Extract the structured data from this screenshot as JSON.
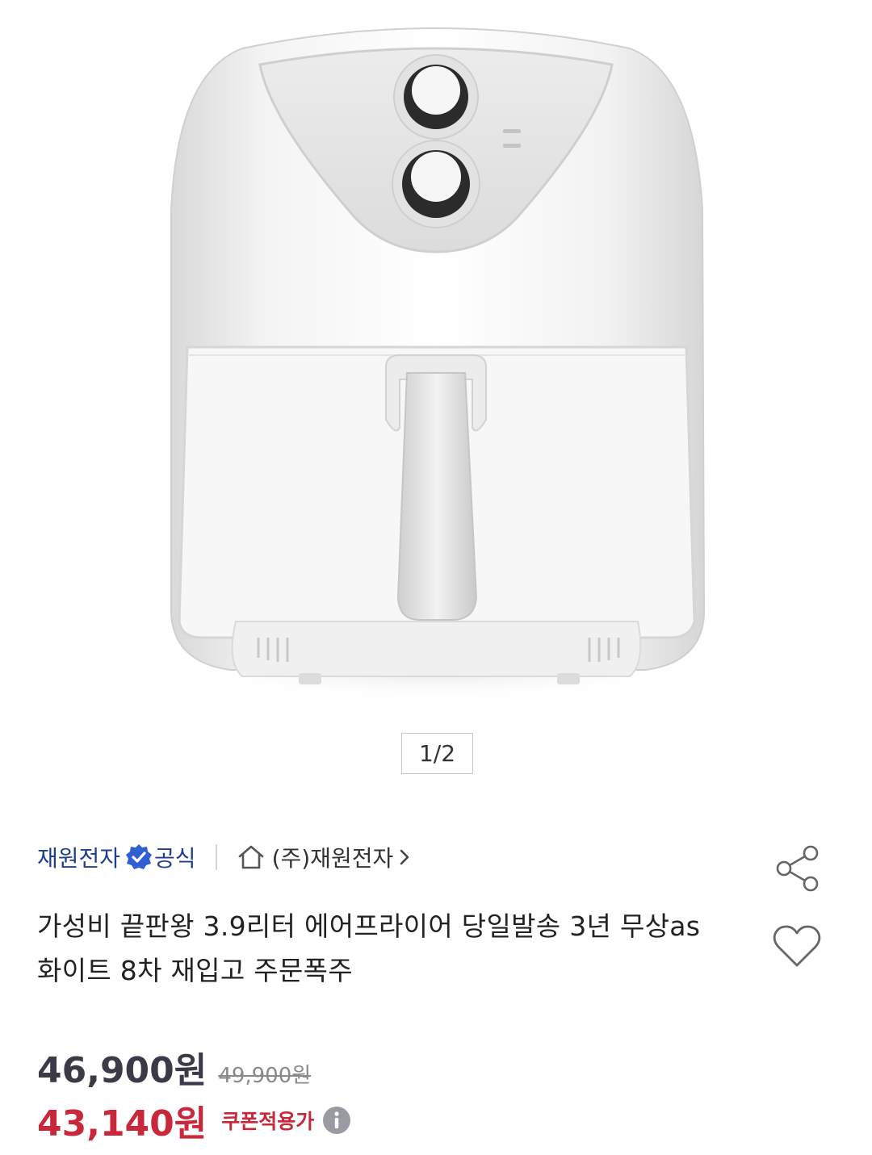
{
  "gallery": {
    "page_indicator": "1/2"
  },
  "seller": {
    "brand": "재원전자",
    "official_label": "공식",
    "store_link": "(주)재원전자"
  },
  "product": {
    "title": "가성비 끝판왕 3.9리터 에어프라이어 당일발송 3년 무상as 화이트 8차 재입고 주문폭주"
  },
  "pricing": {
    "sale_price": "46,900원",
    "original_price": "49,900원",
    "coupon_price": "43,140원",
    "coupon_label": "쿠폰적용가"
  },
  "icons": {
    "badge": "verified-badge-icon",
    "home": "home-icon",
    "chevron": "chevron-right-icon",
    "share": "share-icon",
    "wishlist": "heart-icon",
    "info": "info-icon"
  },
  "colors": {
    "brand_blue": "#1d3f8f",
    "badge_blue": "#2f5fd0",
    "coupon_red": "#c8283a",
    "price_dark": "#3b3b47"
  }
}
